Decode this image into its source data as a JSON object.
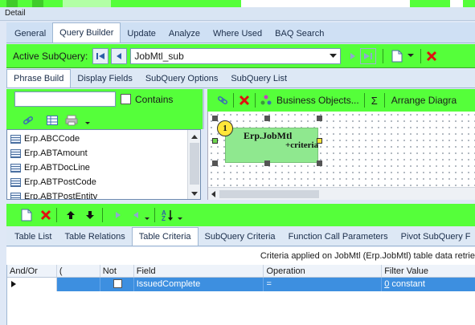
{
  "window": {
    "section_title": "Detail"
  },
  "main_tabs": [
    {
      "label": "General",
      "active": false
    },
    {
      "label": "Query Builder",
      "active": true
    },
    {
      "label": "Update",
      "active": false
    },
    {
      "label": "Analyze",
      "active": false
    },
    {
      "label": "Where Used",
      "active": false
    },
    {
      "label": "BAQ Search",
      "active": false
    }
  ],
  "subquery_bar": {
    "label": "Active SubQuery:",
    "selected": "JobMtl_sub"
  },
  "sub_tabs": [
    {
      "label": "Phrase Build",
      "active": true
    },
    {
      "label": "Display Fields",
      "active": false
    },
    {
      "label": "SubQuery Options",
      "active": false
    },
    {
      "label": "SubQuery List",
      "active": false
    }
  ],
  "search": {
    "value": "",
    "contains_label": "Contains",
    "contains_checked": false
  },
  "tables": [
    "Erp.ABCCode",
    "Erp.ABTAmount",
    "Erp.ABTDocLine",
    "Erp.ABTPostCode",
    "Erp.ABTPostEntity"
  ],
  "diagram_toolbar": {
    "business_objects_label": "Business Objects...",
    "sigma_label": "Σ",
    "arrange_label": "Arrange Diagra"
  },
  "diagram_node": {
    "number": "1",
    "title": "Erp.JobMtl",
    "subtitle": "+criteria"
  },
  "bottom_tabs": [
    {
      "label": "Table List",
      "active": false
    },
    {
      "label": "Table Relations",
      "active": false
    },
    {
      "label": "Table Criteria",
      "active": true
    },
    {
      "label": "SubQuery Criteria",
      "active": false
    },
    {
      "label": "Function Call Parameters",
      "active": false
    },
    {
      "label": "Pivot SubQuery F",
      "active": false
    }
  ],
  "criteria_info": "Criteria applied on JobMtl (Erp.JobMtl)  table data retrie",
  "grid": {
    "headers": [
      "And/Or",
      "(",
      "Not",
      "Field",
      "Operation",
      "Filter Value"
    ],
    "rows": [
      {
        "andor": "",
        "paren": "",
        "not": false,
        "field": "IssuedComplete",
        "operation": "=",
        "filter_num": "0",
        "filter_text": "constant"
      }
    ]
  },
  "colors": {
    "toolbar_green": "#55ff3a",
    "selected_row": "#3d8fe0"
  }
}
